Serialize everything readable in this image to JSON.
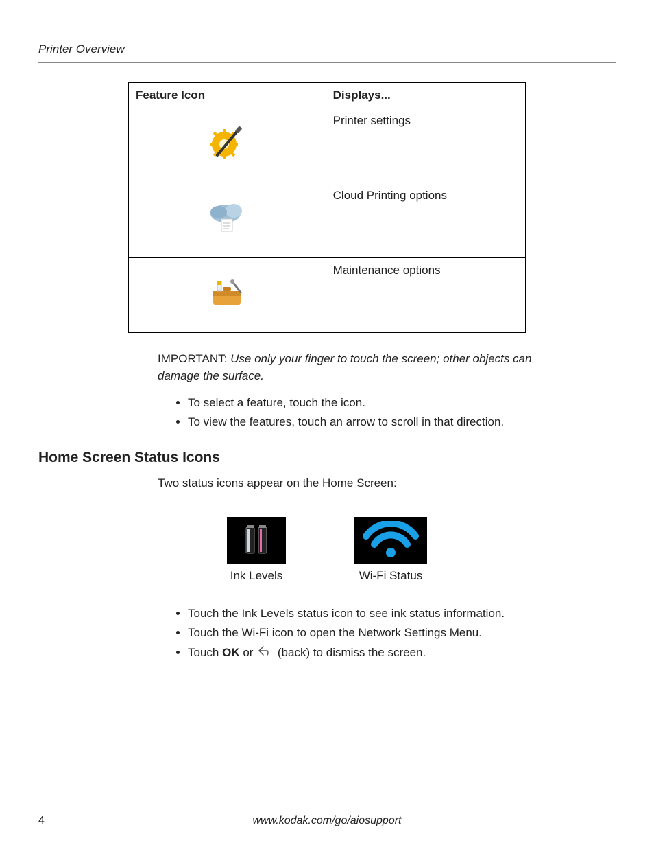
{
  "header": {
    "title": "Printer Overview"
  },
  "table": {
    "header": {
      "col1": "Feature Icon",
      "col2": "Displays..."
    },
    "rows": [
      {
        "icon": "settings-gear-icon",
        "desc": "Printer settings"
      },
      {
        "icon": "cloud-print-icon",
        "desc": "Cloud Printing options"
      },
      {
        "icon": "maintenance-toolbox-icon",
        "desc": "Maintenance options"
      }
    ]
  },
  "important": {
    "label": "IMPORTANT:",
    "text": "Use only your finger to touch the screen; other objects can damage the surface."
  },
  "bullets1": [
    "To select a feature, touch the icon.",
    "To view the features, touch an arrow to scroll in that direction."
  ],
  "section_heading": "Home Screen Status Icons",
  "status_intro": "Two status icons appear on the Home Screen:",
  "status_icons": {
    "ink": {
      "label": "Ink Levels"
    },
    "wifi": {
      "label": "Wi-Fi Status"
    }
  },
  "bullets2": {
    "item1": "Touch the Ink Levels status icon to see ink status information.",
    "item2": "Touch the Wi-Fi icon to open the Network Settings Menu.",
    "item3": {
      "prefix": "Touch ",
      "ok": "OK",
      "middle": " or ",
      "back_label": " (back) to dismiss the screen."
    }
  },
  "footer": {
    "page": "4",
    "url": "www.kodak.com/go/aiosupport"
  }
}
